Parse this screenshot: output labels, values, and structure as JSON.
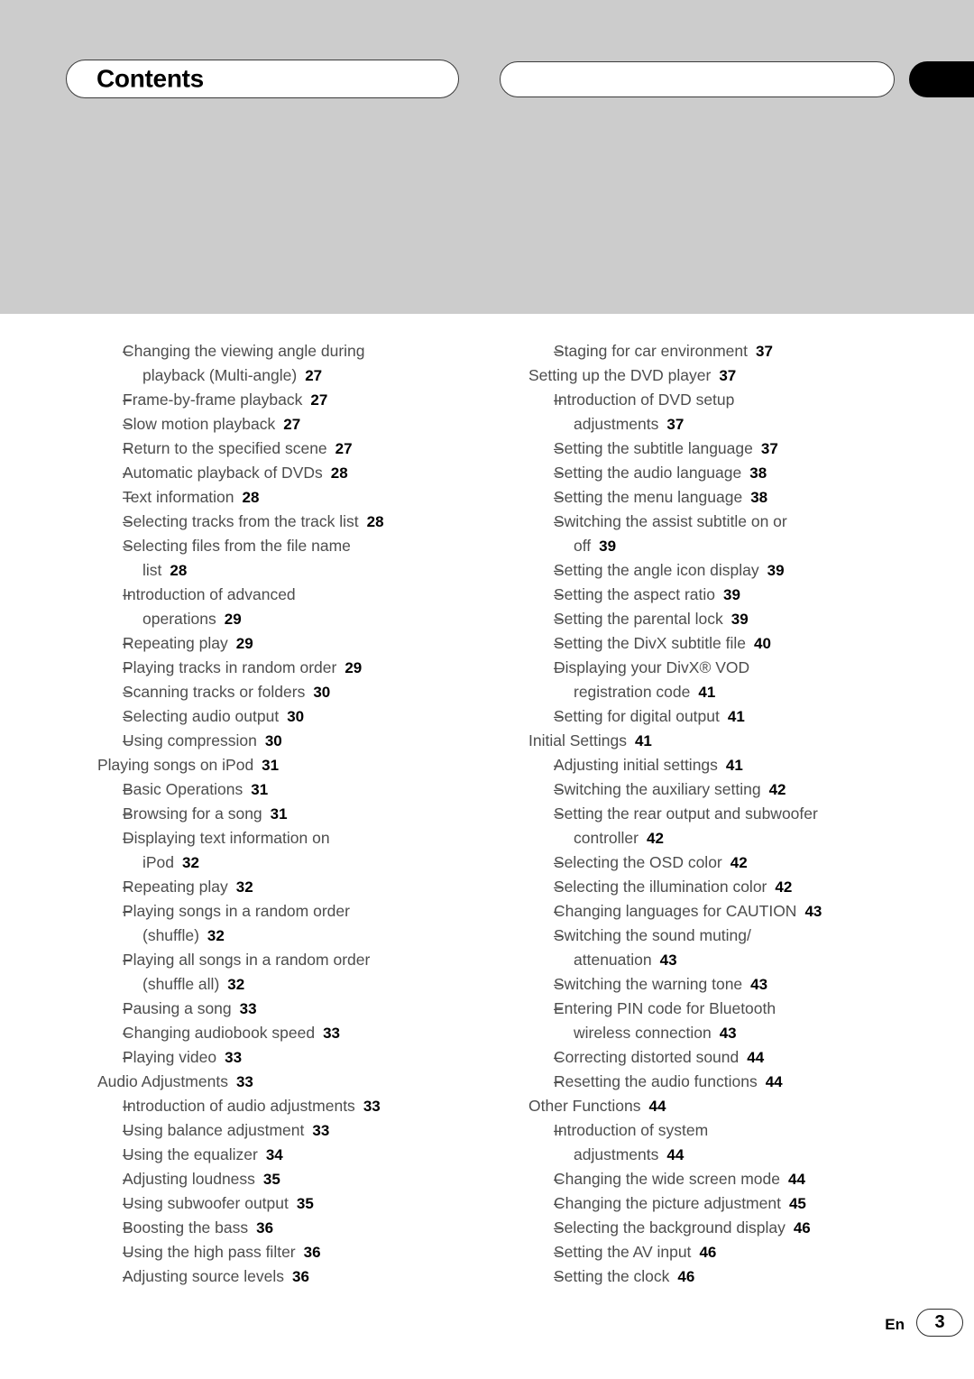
{
  "header": {
    "title": "Contents",
    "secondary_pill_label": "",
    "edge_tab_label": ""
  },
  "footer": {
    "language": "En",
    "page_number": "3"
  },
  "colors": {
    "header_band": "#cccccc",
    "text": "#4d4d4d",
    "page_number": "#000000",
    "edge_tab": "#000000"
  },
  "left_column": [
    {
      "level": 2,
      "label": "Changing the viewing angle during",
      "page": ""
    },
    {
      "level": 2,
      "cont": true,
      "label": "playback (Multi-angle)",
      "page": "27"
    },
    {
      "level": 2,
      "label": "Frame-by-frame playback",
      "page": "27"
    },
    {
      "level": 2,
      "label": "Slow motion playback",
      "page": "27"
    },
    {
      "level": 2,
      "label": "Return to the specified scene",
      "page": "27"
    },
    {
      "level": 2,
      "label": "Automatic playback of DVDs",
      "page": "28"
    },
    {
      "level": 2,
      "label": "Text information",
      "page": "28"
    },
    {
      "level": 2,
      "label": "Selecting tracks from the track list",
      "page": "28"
    },
    {
      "level": 2,
      "label": "Selecting files from the file name",
      "page": ""
    },
    {
      "level": 2,
      "cont": true,
      "label": "list",
      "page": "28"
    },
    {
      "level": 2,
      "label": "Introduction of advanced",
      "page": ""
    },
    {
      "level": 2,
      "cont": true,
      "label": "operations",
      "page": "29"
    },
    {
      "level": 2,
      "label": "Repeating play",
      "page": "29"
    },
    {
      "level": 2,
      "label": "Playing tracks in random order",
      "page": "29"
    },
    {
      "level": 2,
      "label": "Scanning tracks or folders",
      "page": "30"
    },
    {
      "level": 2,
      "label": "Selecting audio output",
      "page": "30"
    },
    {
      "level": 2,
      "label": "Using compression",
      "page": "30"
    },
    {
      "level": 1,
      "label": "Playing songs on iPod",
      "page": "31"
    },
    {
      "level": 2,
      "label": "Basic Operations",
      "page": "31"
    },
    {
      "level": 2,
      "label": "Browsing for a song",
      "page": "31"
    },
    {
      "level": 2,
      "label": "Displaying text information on",
      "page": ""
    },
    {
      "level": 2,
      "cont": true,
      "label": "iPod",
      "page": "32"
    },
    {
      "level": 2,
      "label": "Repeating play",
      "page": "32"
    },
    {
      "level": 2,
      "label": "Playing songs in a random order",
      "page": ""
    },
    {
      "level": 2,
      "cont": true,
      "label": "(shuffle)",
      "page": "32"
    },
    {
      "level": 2,
      "label": "Playing all songs in a random order",
      "page": ""
    },
    {
      "level": 2,
      "cont": true,
      "label": "(shuffle all)",
      "page": "32"
    },
    {
      "level": 2,
      "label": "Pausing a song",
      "page": "33"
    },
    {
      "level": 2,
      "label": "Changing audiobook speed",
      "page": "33"
    },
    {
      "level": 2,
      "label": "Playing video",
      "page": "33"
    },
    {
      "level": 1,
      "label": "Audio Adjustments",
      "page": "33"
    },
    {
      "level": 2,
      "label": "Introduction of audio adjustments",
      "page": "33"
    },
    {
      "level": 2,
      "label": "Using balance adjustment",
      "page": "33"
    },
    {
      "level": 2,
      "label": "Using the equalizer",
      "page": "34"
    },
    {
      "level": 2,
      "label": "Adjusting loudness",
      "page": "35"
    },
    {
      "level": 2,
      "label": "Using subwoofer output",
      "page": "35"
    },
    {
      "level": 2,
      "label": "Boosting the bass",
      "page": "36"
    },
    {
      "level": 2,
      "label": "Using the high pass filter",
      "page": "36"
    },
    {
      "level": 2,
      "label": "Adjusting source levels",
      "page": "36"
    }
  ],
  "right_column": [
    {
      "level": 2,
      "label": "Staging for car environment",
      "page": "37"
    },
    {
      "level": 1,
      "label": "Setting up the DVD player",
      "page": "37"
    },
    {
      "level": 2,
      "label": "Introduction of DVD setup",
      "page": ""
    },
    {
      "level": 2,
      "cont": true,
      "label": "adjustments",
      "page": "37"
    },
    {
      "level": 2,
      "label": "Setting the subtitle language",
      "page": "37"
    },
    {
      "level": 2,
      "label": "Setting the audio language",
      "page": "38"
    },
    {
      "level": 2,
      "label": "Setting the menu language",
      "page": "38"
    },
    {
      "level": 2,
      "label": "Switching the assist subtitle on or",
      "page": ""
    },
    {
      "level": 2,
      "cont": true,
      "label": "off",
      "page": "39"
    },
    {
      "level": 2,
      "label": "Setting the angle icon display",
      "page": "39"
    },
    {
      "level": 2,
      "label": "Setting the aspect ratio",
      "page": "39"
    },
    {
      "level": 2,
      "label": "Setting the parental lock",
      "page": "39"
    },
    {
      "level": 2,
      "label": "Setting the DivX subtitle file",
      "page": "40"
    },
    {
      "level": 2,
      "label": "Displaying your DivX® VOD",
      "page": ""
    },
    {
      "level": 2,
      "cont": true,
      "label": "registration code",
      "page": "41"
    },
    {
      "level": 2,
      "label": "Setting for digital output",
      "page": "41"
    },
    {
      "level": 1,
      "label": "Initial Settings",
      "page": "41"
    },
    {
      "level": 2,
      "label": "Adjusting initial settings",
      "page": "41"
    },
    {
      "level": 2,
      "label": "Switching the auxiliary setting",
      "page": "42"
    },
    {
      "level": 2,
      "label": "Setting the rear output and subwoofer",
      "page": ""
    },
    {
      "level": 2,
      "cont": true,
      "label": "controller",
      "page": "42"
    },
    {
      "level": 2,
      "label": "Selecting the OSD color",
      "page": "42"
    },
    {
      "level": 2,
      "label": "Selecting the illumination color",
      "page": "42"
    },
    {
      "level": 2,
      "label": "Changing languages for CAUTION",
      "page": "43"
    },
    {
      "level": 2,
      "label": "Switching the sound muting/",
      "page": ""
    },
    {
      "level": 2,
      "cont": true,
      "label": "attenuation",
      "page": "43"
    },
    {
      "level": 2,
      "label": "Switching the warning tone",
      "page": "43"
    },
    {
      "level": 2,
      "label": "Entering PIN code for Bluetooth",
      "page": ""
    },
    {
      "level": 2,
      "cont": true,
      "label": "wireless connection",
      "page": "43"
    },
    {
      "level": 2,
      "label": "Correcting distorted sound",
      "page": "44"
    },
    {
      "level": 2,
      "label": "Resetting the audio functions",
      "page": "44"
    },
    {
      "level": 1,
      "label": "Other Functions",
      "page": "44"
    },
    {
      "level": 2,
      "label": "Introduction of system",
      "page": ""
    },
    {
      "level": 2,
      "cont": true,
      "label": "adjustments",
      "page": "44"
    },
    {
      "level": 2,
      "label": "Changing the wide screen mode",
      "page": "44"
    },
    {
      "level": 2,
      "label": "Changing the picture adjustment",
      "page": "45"
    },
    {
      "level": 2,
      "label": "Selecting the background display",
      "page": "46"
    },
    {
      "level": 2,
      "label": "Setting the AV input",
      "page": "46"
    },
    {
      "level": 2,
      "label": "Setting the clock",
      "page": "46"
    }
  ]
}
